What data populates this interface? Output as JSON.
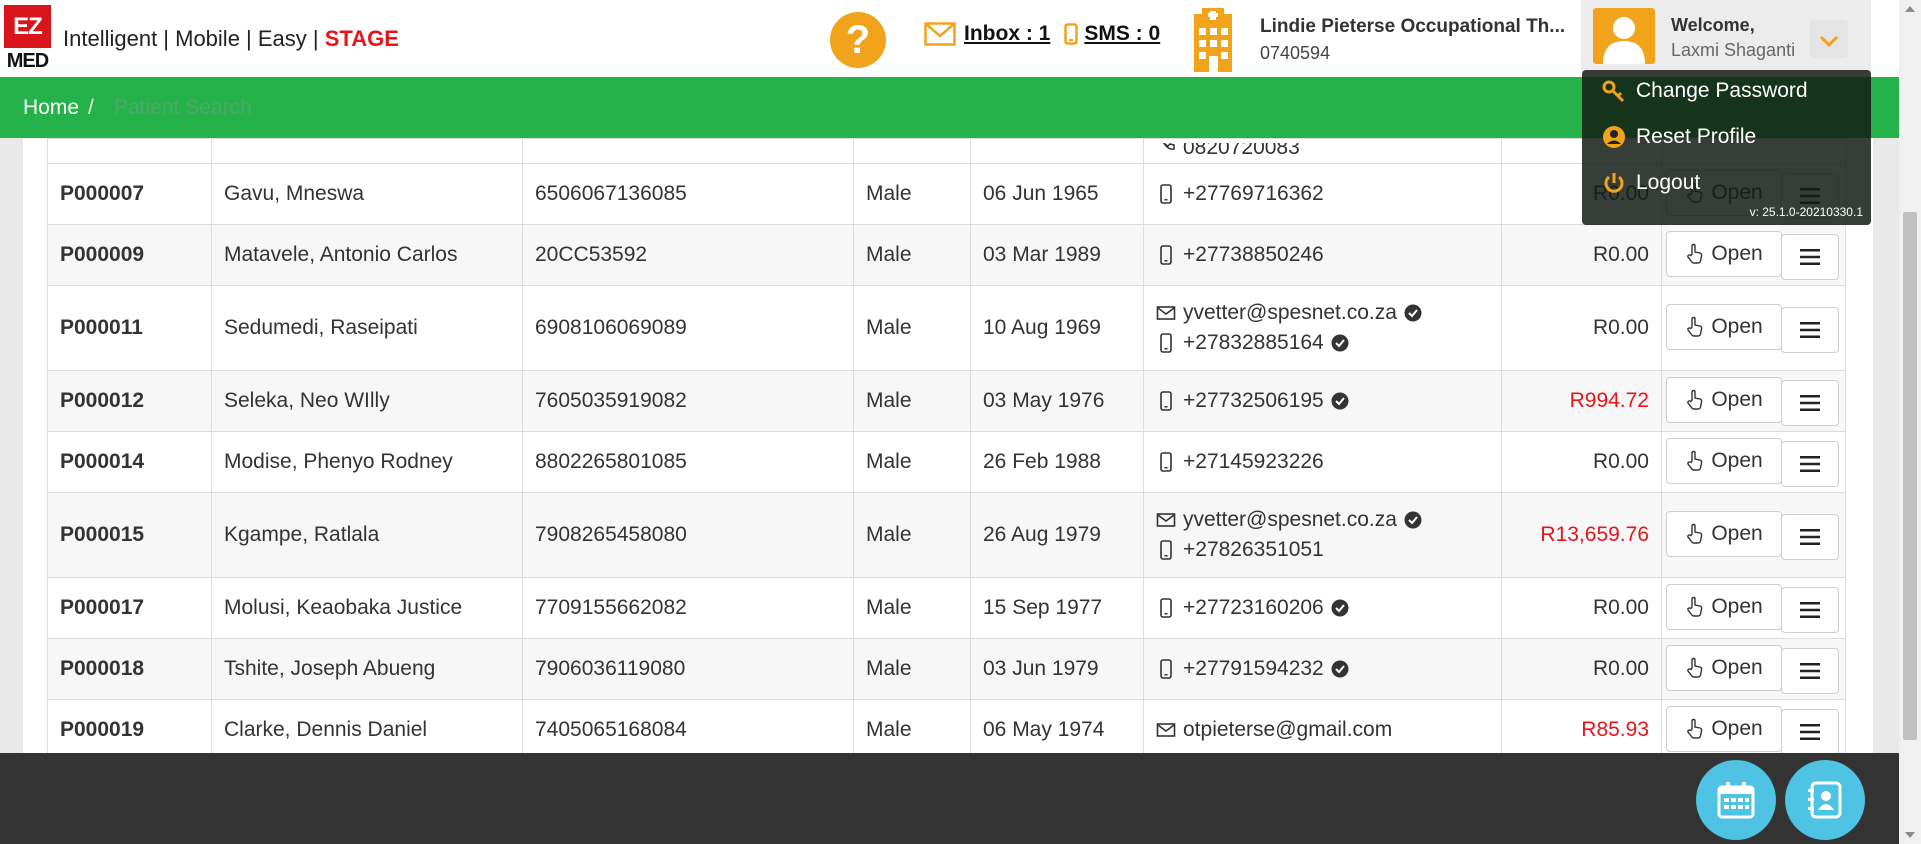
{
  "brand": {
    "logo_top": "EZ",
    "logo_bottom": "MED",
    "tagline": "Intelligent | Mobile | Easy | ",
    "stage": "STAGE",
    "stage_color": "#e8141b"
  },
  "header": {
    "help_label": "?",
    "inbox_label": "Inbox : 1",
    "sms_label": "SMS : 0",
    "clinic_name": "Lindie Pieterse Occupational Th...",
    "clinic_number": "0740594"
  },
  "user": {
    "welcome": "Welcome,",
    "name": "Laxmi Shaganti"
  },
  "user_menu": {
    "items": [
      {
        "label": "Change Password",
        "icon": "key-icon"
      },
      {
        "label": "Reset Profile",
        "icon": "user-circle-icon"
      },
      {
        "label": "Logout",
        "icon": "power-icon"
      }
    ],
    "version": "v: 25.1.0-20210330.1"
  },
  "breadcrumb": {
    "home": "Home",
    "separator": "/",
    "current": "Patient Search"
  },
  "table": {
    "open_label": "Open",
    "partial_top_phone": "0820720083",
    "rows": [
      {
        "id": "P000007",
        "name": "Gavu, Mneswa",
        "idnum": "6506067136085",
        "gender": "Male",
        "dob": "06 Jun 1965",
        "email": "",
        "email_verified": false,
        "phone": "+27769716362",
        "phone_verified": false,
        "balance": "R0.00",
        "negative": false
      },
      {
        "id": "P000009",
        "name": "Matavele, Antonio Carlos",
        "idnum": "20CC53592",
        "gender": "Male",
        "dob": "03 Mar 1989",
        "email": "",
        "email_verified": false,
        "phone": "+27738850246",
        "phone_verified": false,
        "balance": "R0.00",
        "negative": false
      },
      {
        "id": "P000011",
        "name": "Sedumedi, Raseipati",
        "idnum": "6908106069089",
        "gender": "Male",
        "dob": "10 Aug 1969",
        "email": "yvetter@spesnet.co.za",
        "email_verified": true,
        "phone": "+27832885164",
        "phone_verified": true,
        "balance": "R0.00",
        "negative": false
      },
      {
        "id": "P000012",
        "name": "Seleka, Neo WIlly",
        "idnum": "7605035919082",
        "gender": "Male",
        "dob": "03 May 1976",
        "email": "",
        "email_verified": false,
        "phone": "+27732506195",
        "phone_verified": true,
        "balance": "R994.72",
        "negative": true
      },
      {
        "id": "P000014",
        "name": "Modise, Phenyo Rodney",
        "idnum": "8802265801085",
        "gender": "Male",
        "dob": "26 Feb 1988",
        "email": "",
        "email_verified": false,
        "phone": "+27145923226",
        "phone_verified": false,
        "balance": "R0.00",
        "negative": false
      },
      {
        "id": "P000015",
        "name": "Kgampe, Ratlala",
        "idnum": "7908265458080",
        "gender": "Male",
        "dob": "26 Aug 1979",
        "email": "yvetter@spesnet.co.za",
        "email_verified": true,
        "phone": "+27826351051",
        "phone_verified": false,
        "balance": "R13,659.76",
        "negative": true
      },
      {
        "id": "P000017",
        "name": "Molusi, Keaobaka Justice",
        "idnum": "7709155662082",
        "gender": "Male",
        "dob": "15 Sep 1977",
        "email": "",
        "email_verified": false,
        "phone": "+27723160206",
        "phone_verified": true,
        "balance": "R0.00",
        "negative": false
      },
      {
        "id": "P000018",
        "name": "Tshite, Joseph Abueng",
        "idnum": "7906036119080",
        "gender": "Male",
        "dob": "03 Jun 1979",
        "email": "",
        "email_verified": false,
        "phone": "+27791594232",
        "phone_verified": true,
        "balance": "R0.00",
        "negative": false
      },
      {
        "id": "P000019",
        "name": "Clarke, Dennis Daniel",
        "idnum": "7405065168084",
        "gender": "Male",
        "dob": "06 May 1974",
        "email": "otpieterse@gmail.com",
        "email_verified": false,
        "phone": "",
        "phone_verified": false,
        "balance": "R85.93",
        "negative": true
      }
    ]
  },
  "footer": {
    "buttons": [
      {
        "icon": "calendar-icon"
      },
      {
        "icon": "contacts-icon"
      }
    ]
  },
  "colors": {
    "green_bar": "#25b24a",
    "accent_orange": "#f2a31c",
    "fab_blue": "#4fc3e3",
    "footer_dark": "#333333",
    "negative_red": "#e8141b"
  }
}
